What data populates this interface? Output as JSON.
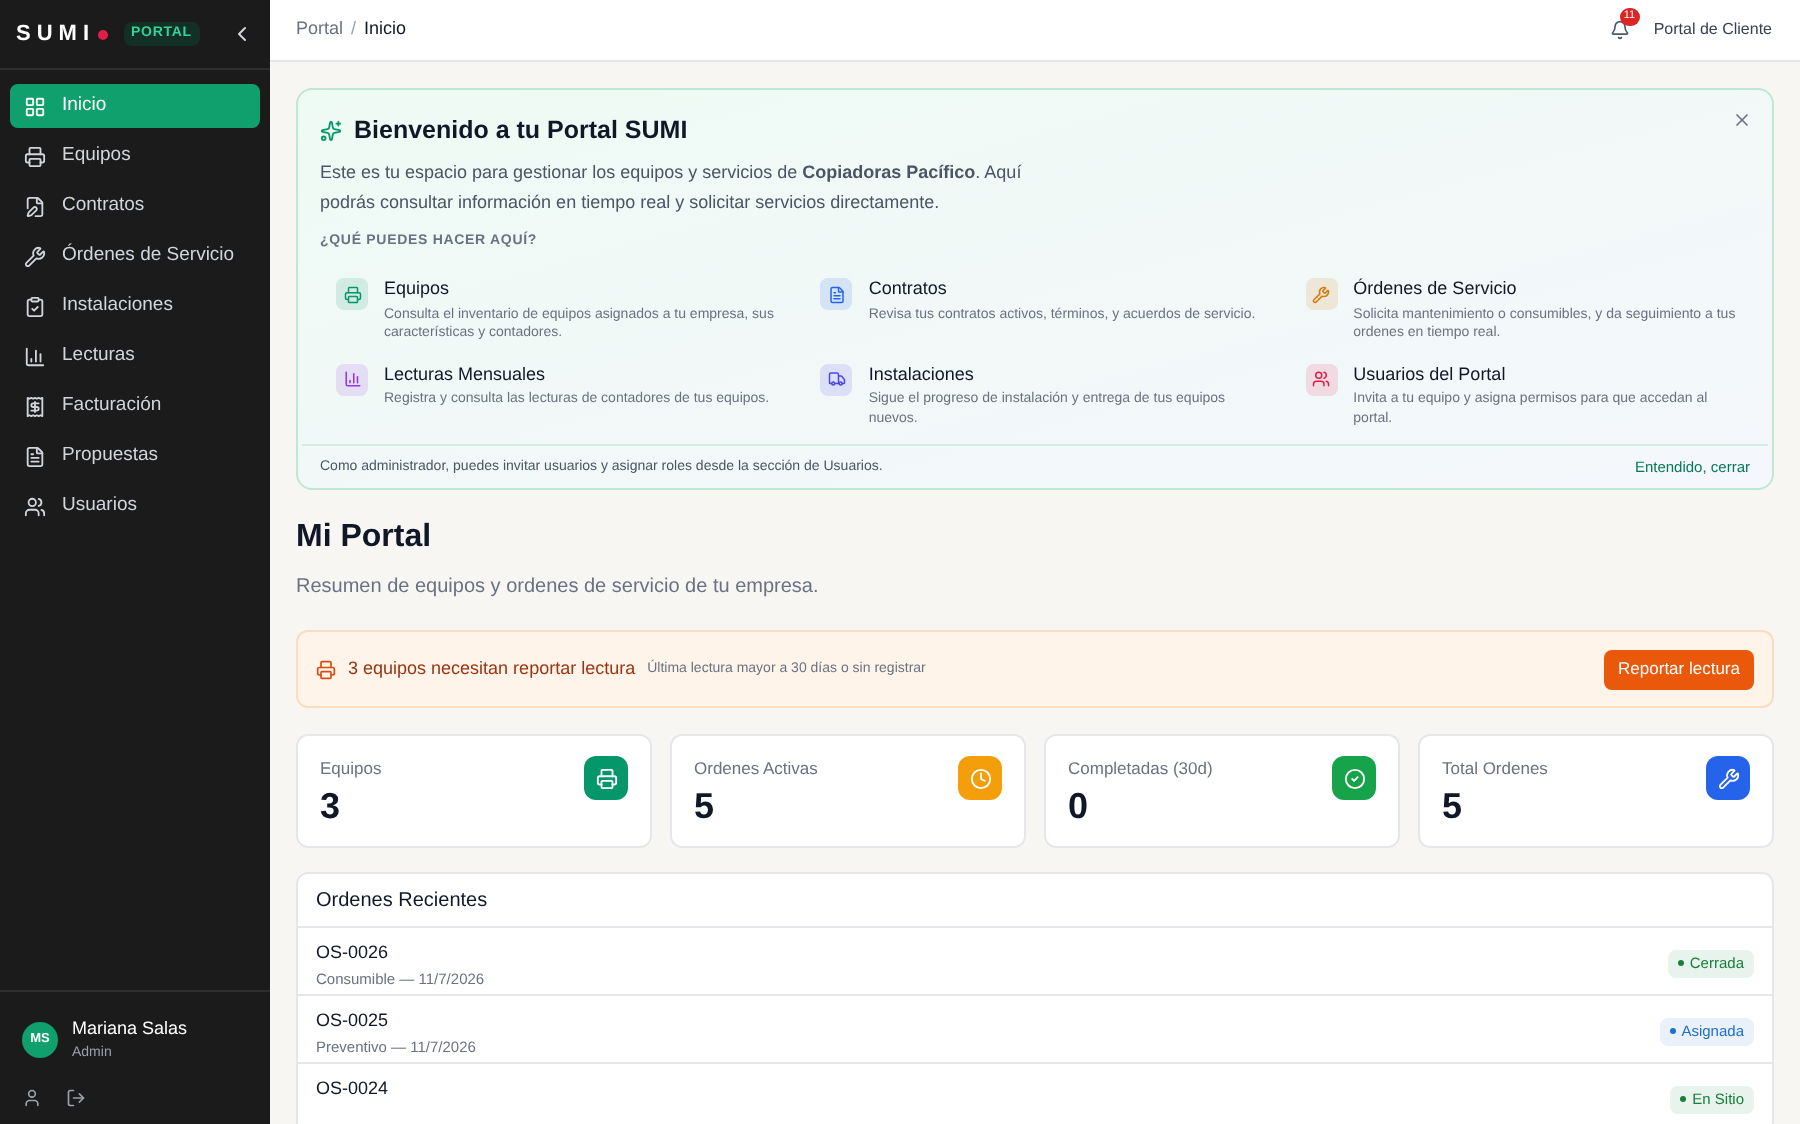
{
  "sidebar": {
    "logo": "SUMI",
    "badge": "PORTAL",
    "items": [
      {
        "label": "Inicio",
        "selected": true
      },
      {
        "label": "Equipos",
        "selected": false
      },
      {
        "label": "Contratos",
        "selected": false
      },
      {
        "label": "Órdenes de Servicio",
        "selected": false
      },
      {
        "label": "Instalaciones",
        "selected": false
      },
      {
        "label": "Lecturas",
        "selected": false
      },
      {
        "label": "Facturación",
        "selected": false
      },
      {
        "label": "Propuestas",
        "selected": false
      },
      {
        "label": "Usuarios",
        "selected": false
      }
    ],
    "user": {
      "initials": "MS",
      "name": "Mariana Salas",
      "role": "Admin"
    }
  },
  "header": {
    "breadcrumb": [
      "Portal",
      "Inicio"
    ],
    "separator": "/",
    "notifications": "11",
    "portal_label": "Portal de Cliente"
  },
  "welcome": {
    "title": "Bienvenido a tu Portal SUMI",
    "intro": "Este es tu espacio para gestionar los equipos y servicios de **Copiadoras Pacífico**. Aquí podrás consultar información en tiempo real y solicitar servicios directamente.",
    "section": "¿QUÉ PUEDES HACER AQUÍ?",
    "features": [
      {
        "title": "Equipos",
        "text": "Consulta el inventario de equipos asignados a tu empresa, sus características y contadores.",
        "color": "#059669"
      },
      {
        "title": "Contratos",
        "text": "Revisa tus contratos activos, términos, y acuerdos de servicio.",
        "color": "#2563eb"
      },
      {
        "title": "Órdenes de Servicio",
        "text": "Solicita mantenimiento o consumibles, y da seguimiento a tus ordenes en tiempo real.",
        "color": "#d97706"
      },
      {
        "title": "Lecturas Mensuales",
        "text": "Registra y consulta las lecturas de contadores de tus equipos.",
        "color": "#9333ea"
      },
      {
        "title": "Instalaciones",
        "text": "Sigue el progreso de instalación y entrega de tus equipos nuevos.",
        "color": "#4f46e5"
      },
      {
        "title": "Usuarios del Portal",
        "text": "Invita a tu equipo y asigna permisos para que accedan al portal.",
        "color": "#e11d48"
      }
    ],
    "footer": "Como administrador, puedes invitar usuarios y asignar roles desde la sección de Usuarios.",
    "dismiss": "Entendido, cerrar"
  },
  "page": {
    "title": "Mi Portal",
    "subtitle": "Resumen de equipos y ordenes de servicio de tu empresa."
  },
  "alert": {
    "message": "3 equipos necesitan reportar lectura",
    "detail": "Última lectura mayor a 30 días o sin registrar",
    "button": "Reportar lectura"
  },
  "stats": [
    {
      "label": "Equipos",
      "value": "3",
      "color": "#059669"
    },
    {
      "label": "Ordenes Activas",
      "value": "5",
      "color": "#f59e0b"
    },
    {
      "label": "Completadas (30d)",
      "value": "0",
      "color": "#16a34a"
    },
    {
      "label": "Total Ordenes",
      "value": "5",
      "color": "#2563eb"
    }
  ],
  "orders": {
    "title": "Ordenes Recientes",
    "rows": [
      {
        "id": "OS-0026",
        "detail": "Consumible — 11/7/2026",
        "status": "Cerrada",
        "color": "#15803d"
      },
      {
        "id": "OS-0025",
        "detail": "Preventivo — 11/7/2026",
        "status": "Asignada",
        "color": "#1d6fd1"
      },
      {
        "id": "OS-0024",
        "status": "En Sitio",
        "color": "#15803d"
      }
    ]
  }
}
